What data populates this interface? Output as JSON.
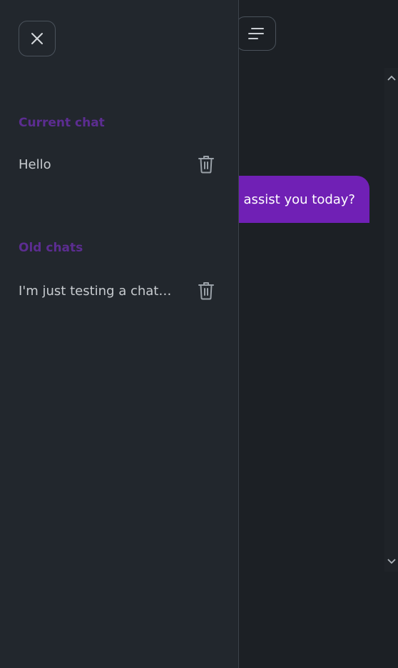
{
  "background_chat": {
    "menu_button": {
      "icon": "menu-lines-icon"
    },
    "message": {
      "text": "assist you today?"
    },
    "scrollbar": {
      "up_icon": "chevron-up-icon",
      "down_icon": "chevron-down-icon"
    }
  },
  "sidebar": {
    "close_icon": "close-icon",
    "current_section": {
      "heading": "Current chat",
      "items": [
        {
          "title": "Hello",
          "delete_icon": "trash-icon"
        }
      ]
    },
    "old_section": {
      "heading": "Old chats",
      "items": [
        {
          "title": "I'm just testing a chatGPT clone",
          "delete_icon": "trash-icon"
        }
      ]
    }
  },
  "colors": {
    "accent_purple": "#7020b5",
    "heading_purple": "#5c2d91",
    "sidebar_bg": "#22272d",
    "page_bg": "#1c2025",
    "text_light": "#c8ccd0"
  }
}
